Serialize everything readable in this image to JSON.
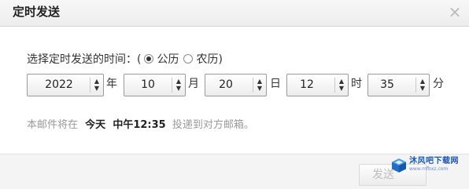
{
  "dialog": {
    "title": "定时发送",
    "close_glyph": "×"
  },
  "prompt": {
    "label": "选择定时发送的时间：(",
    "options": [
      {
        "label": "公历",
        "checked": true
      },
      {
        "label": "农历)",
        "checked": false
      }
    ]
  },
  "datetime": {
    "year": {
      "value": "2022",
      "unit": "年"
    },
    "month": {
      "value": "10",
      "unit": "月"
    },
    "day": {
      "value": "20",
      "unit": "日"
    },
    "hour": {
      "value": "12",
      "unit": "时"
    },
    "minute": {
      "value": "35",
      "unit": "分"
    },
    "arrow_up": "▲",
    "arrow_down": "▼"
  },
  "info": {
    "prefix": "本邮件将在",
    "day": "今天",
    "time": "中午12:35",
    "suffix": "投递到对方邮箱。"
  },
  "footer": {
    "send_label": "发送"
  },
  "watermark": {
    "name": "沐风吧下载网",
    "site": "www.mfbxz.com"
  }
}
